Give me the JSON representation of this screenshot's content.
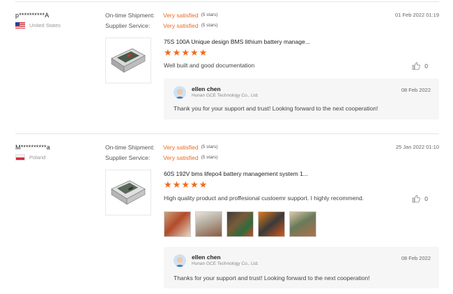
{
  "reviews": [
    {
      "buyer": "p**********A",
      "country": "United States",
      "shipment_label": "On-time Shipment:",
      "shipment_value": "Very satisfied",
      "shipment_note": "(5 stars)",
      "service_label": "Supplier Service:",
      "service_value": "Very satisfied",
      "service_note": "(5 stars)",
      "date": "01 Feb 2022 01:19",
      "product_title": "75S 100A Unique design BMS lithium battery manage...",
      "stars": 5,
      "text": "Well built and good documentation",
      "likes": "0",
      "reply": {
        "name": "ellen chen",
        "company": "Hunan GCE Technology Co., Ltd.",
        "date": "08 Feb 2022",
        "text": "Thank you for your support and trust! Looking forward to the next cooperation!"
      }
    },
    {
      "buyer": "M**********a",
      "country": "Poland",
      "shipment_label": "On-time Shipment:",
      "shipment_value": "Very satisfied",
      "shipment_note": "(5 stars)",
      "service_label": "Supplier Service:",
      "service_value": "Very satisfied",
      "service_note": "(5 stars)",
      "date": "25 Jan 2022 01:10",
      "product_title": "60S 192V bms lifepo4 battery management system 1...",
      "stars": 5,
      "text": "High quality product and proffesional custoemr support. I highly recommend.",
      "likes": "0",
      "photo_count": 5,
      "reply": {
        "name": "ellen chen",
        "company": "Hunan GCE Technology Co., Ltd.",
        "date": "08 Feb 2022",
        "text": "Thanks for your support and trust! Looking forward to the next cooperation!"
      }
    }
  ],
  "colors": {
    "accent": "#f06a1d",
    "reply_bg": "#f6f6f6",
    "divider": "#e6e6e6"
  },
  "icons": {
    "like": "thumbs-up-icon",
    "star": "star-icon"
  }
}
